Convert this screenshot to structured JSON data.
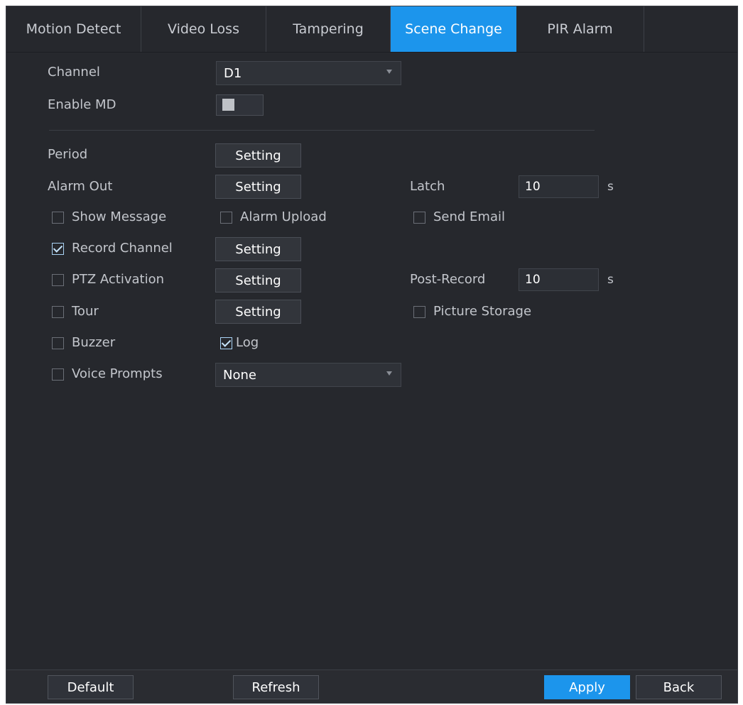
{
  "tabs": [
    {
      "label": "Motion Detect"
    },
    {
      "label": "Video Loss"
    },
    {
      "label": "Tampering"
    },
    {
      "label": "Scene Change",
      "active": true
    },
    {
      "label": "PIR Alarm"
    }
  ],
  "form": {
    "channel_label": "Channel",
    "channel_value": "D1",
    "enable_label": "Enable MD",
    "period_label": "Period",
    "alarm_out_label": "Alarm Out",
    "latch_label": "Latch",
    "latch_value": "10",
    "latch_unit": "s",
    "setting_label": "Setting",
    "show_message": {
      "label": "Show Message",
      "checked": false
    },
    "alarm_upload": {
      "label": "Alarm Upload",
      "checked": false
    },
    "send_email": {
      "label": "Send Email",
      "checked": false
    },
    "record_channel": {
      "label": "Record Channel",
      "checked": true
    },
    "ptz_activation": {
      "label": "PTZ Activation",
      "checked": false
    },
    "post_record_label": "Post-Record",
    "post_record_value": "10",
    "post_record_unit": "s",
    "tour": {
      "label": "Tour",
      "checked": false
    },
    "picture_storage": {
      "label": "Picture Storage",
      "checked": false
    },
    "buzzer": {
      "label": "Buzzer",
      "checked": false
    },
    "log": {
      "label": "Log",
      "checked": true
    },
    "voice_prompts": {
      "label": "Voice Prompts",
      "checked": false
    },
    "voice_prompts_value": "None"
  },
  "footer": {
    "default_label": "Default",
    "refresh_label": "Refresh",
    "apply_label": "Apply",
    "back_label": "Back"
  },
  "colors": {
    "accent": "#1c95ec",
    "panel_bg": "#26282d"
  }
}
